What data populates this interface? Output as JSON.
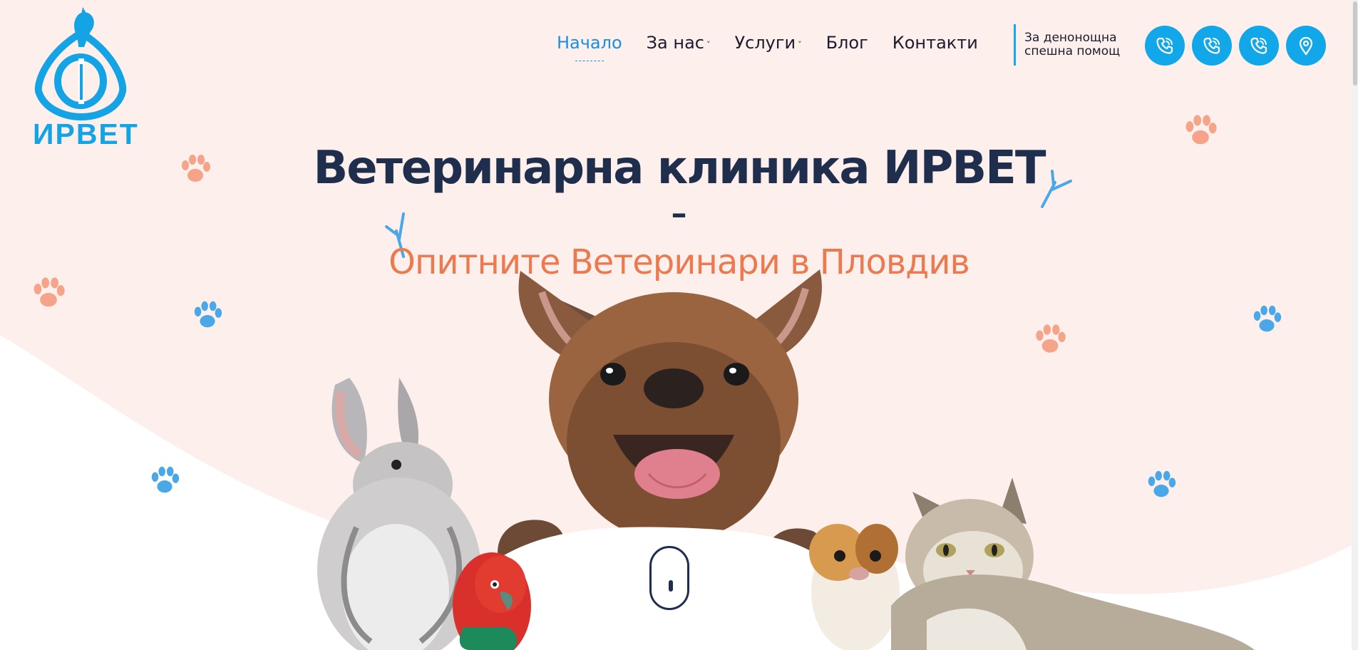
{
  "brand": {
    "name": "ИРВЕТ",
    "color": "#14a4e6"
  },
  "nav": {
    "items": [
      {
        "label": "Начало",
        "active": true,
        "has_dropdown": false
      },
      {
        "label": "За нас",
        "active": false,
        "has_dropdown": true
      },
      {
        "label": "Услуги",
        "active": false,
        "has_dropdown": true
      },
      {
        "label": "Блог",
        "active": false,
        "has_dropdown": false
      },
      {
        "label": "Контакти",
        "active": false,
        "has_dropdown": false
      }
    ],
    "caret": "˅"
  },
  "emergency": {
    "line1": "За денонощна",
    "line2": "спешна помощ"
  },
  "actions": [
    {
      "icon": "phone-icon"
    },
    {
      "icon": "phone-icon"
    },
    {
      "icon": "phone-icon"
    },
    {
      "icon": "location-pin-icon"
    }
  ],
  "hero": {
    "title": "Ветеринарна клиника ИРВЕТ",
    "dash": "–",
    "subtitle": "Опитните Ветеринари в Пловдив"
  },
  "images": {
    "animals": [
      "rabbit",
      "parrot",
      "french-bulldog",
      "guinea-pig",
      "cat"
    ]
  },
  "colors": {
    "accent": "#12a7e9",
    "title": "#1f2e4d",
    "subtitle": "#ec7a50",
    "background": "#fdf0ec",
    "paw_orange": "#f5a48a",
    "paw_blue": "#4aa7e8"
  }
}
